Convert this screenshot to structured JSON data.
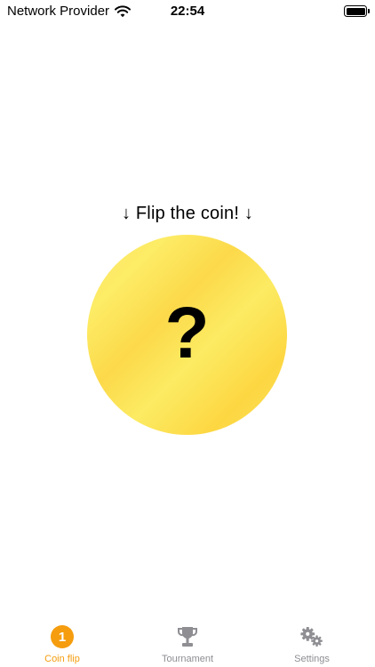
{
  "status_bar": {
    "carrier": "Network Provider",
    "time": "22:54",
    "wifi_icon": "wifi-icon",
    "battery_icon": "battery-icon"
  },
  "main": {
    "prompt": "↓ Flip the coin! ↓",
    "coin_symbol": "?"
  },
  "tab_bar": {
    "active_color": "#f59d0e",
    "inactive_color": "#8e8e93",
    "tabs": [
      {
        "label": "Coin flip",
        "badge": "1",
        "active": true,
        "icon": "coin-badge-icon"
      },
      {
        "label": "Tournament",
        "active": false,
        "icon": "trophy-icon"
      },
      {
        "label": "Settings",
        "active": false,
        "icon": "gears-icon"
      }
    ]
  },
  "colors": {
    "coin_gold": "#fde467",
    "accent": "#f59d0e"
  }
}
